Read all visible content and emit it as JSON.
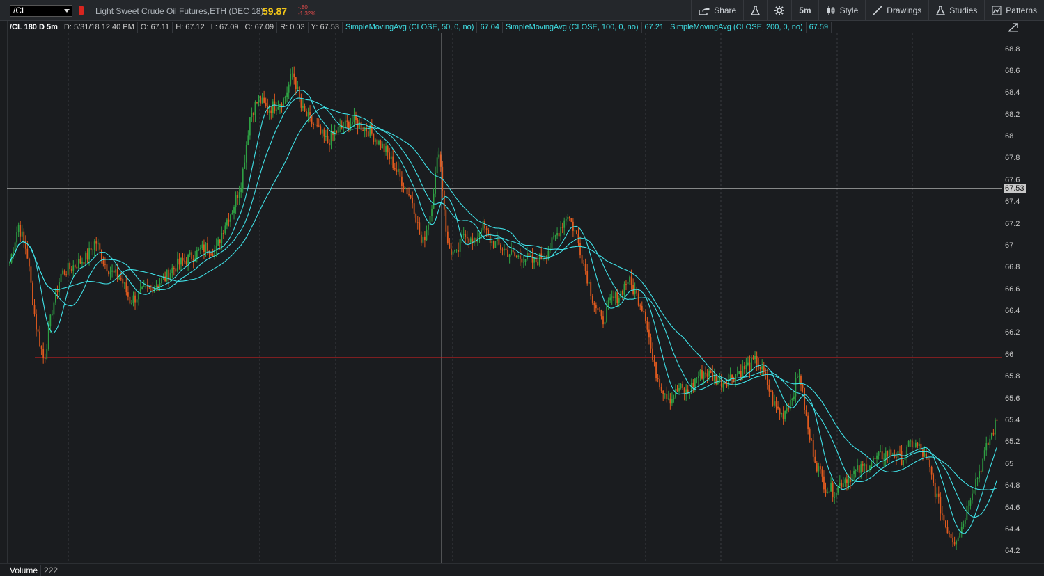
{
  "toolbar": {
    "symbol": "/CL",
    "description": "Light Sweet Crude Oil Futures,ETH (DEC 18)",
    "last_price": "59.87",
    "change": "-.80",
    "change_pct": "-1.32%",
    "share_label": "Share",
    "timeframe_label": "5m",
    "style_label": "Style",
    "drawings_label": "Drawings",
    "studies_label": "Studies",
    "patterns_label": "Patterns"
  },
  "study_bar": {
    "symbol_info": "/CL 180 D 5m",
    "date": "D: 5/31/18 12:40 PM",
    "open": "O: 67.11",
    "high": "H: 67.12",
    "low": "L: 67.09",
    "close": "C: 67.09",
    "range": "R: 0.03",
    "y": "Y: 67.53",
    "sma50_label": "SimpleMovingAvg (CLOSE, 50, 0, no)",
    "sma50_value": "67.04",
    "sma100_label": "SimpleMovingAvg (CLOSE, 100, 0, no)",
    "sma100_value": "67.21",
    "sma200_label": "SimpleMovingAvg (CLOSE, 200, 0, no)",
    "sma200_value": "67.59"
  },
  "price_axis": {
    "ticks": [
      "68.8",
      "68.6",
      "68.4",
      "68.2",
      "68",
      "67.8",
      "67.6",
      "67.4",
      "67.2",
      "67",
      "66.8",
      "66.6",
      "66.4",
      "66.2",
      "66",
      "65.8",
      "65.6",
      "65.4",
      "65.2",
      "65",
      "64.8",
      "64.6",
      "64.4",
      "64.2"
    ],
    "cursor_price": "67.53"
  },
  "volume": {
    "label": "Volume",
    "value": "222"
  },
  "colors": {
    "up_candle": "#2ea043",
    "down_candle": "#e05a1e",
    "sma": "#3fe0e6",
    "level_line": "#e02020",
    "crosshair": "#cfcfcf",
    "price_accent": "#f0c419"
  },
  "chart_data": {
    "type": "line",
    "ylim": [
      64.1,
      68.95
    ],
    "horizontal_level": 65.98,
    "crosshair_price": 67.53,
    "close": [
      66.85,
      67.2,
      66.95,
      66.3,
      65.95,
      66.45,
      66.75,
      66.8,
      66.85,
      66.9,
      67.05,
      66.85,
      66.75,
      66.7,
      66.5,
      66.55,
      66.6,
      66.65,
      66.7,
      66.8,
      66.85,
      66.9,
      66.95,
      67.0,
      66.95,
      67.2,
      67.35,
      67.6,
      68.2,
      68.35,
      68.25,
      68.3,
      68.35,
      68.6,
      68.25,
      68.15,
      68.05,
      67.95,
      68.05,
      68.1,
      68.15,
      68.1,
      68.05,
      67.95,
      67.85,
      67.7,
      67.55,
      67.4,
      67.0,
      67.3,
      67.9,
      67.0,
      66.9,
      67.15,
      67.0,
      67.2,
      67.05,
      67.0,
      66.95,
      66.9,
      66.9,
      66.85,
      66.9,
      67.0,
      67.15,
      67.3,
      67.1,
      66.8,
      66.5,
      66.3,
      66.5,
      66.55,
      66.7,
      66.55,
      66.4,
      65.9,
      65.7,
      65.6,
      65.7,
      65.65,
      65.8,
      65.85,
      65.8,
      65.75,
      65.8,
      65.85,
      65.9,
      65.95,
      65.8,
      65.55,
      65.45,
      65.6,
      65.85,
      65.3,
      65.0,
      64.8,
      64.75,
      64.85,
      64.9,
      64.95,
      65.0,
      65.05,
      65.1,
      65.1,
      65.05,
      65.2,
      65.15,
      65.0,
      64.7,
      64.45,
      64.3,
      64.45,
      64.75,
      64.95,
      65.2,
      65.4
    ],
    "sma50_label": "SimpleMovingAvg (CLOSE, 50, 0, no)",
    "sma100_label": "SimpleMovingAvg (CLOSE, 100, 0, no)",
    "sma200_label": "SimpleMovingAvg (CLOSE, 200, 0, no)"
  }
}
